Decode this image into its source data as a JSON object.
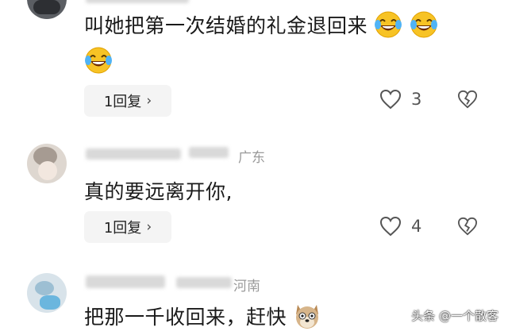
{
  "comments": [
    {
      "text": "叫她把第一次结婚的礼金退回来",
      "emoji": [
        "laughing-tears-emoji",
        "laughing-tears-emoji",
        "laughing-tears-emoji"
      ],
      "reply_label": "1回复",
      "like_count": "3"
    },
    {
      "location": "广东",
      "text": "真的要远离开你,",
      "reply_label": "1回复",
      "like_count": "4"
    },
    {
      "location": "河南",
      "text": "把那一千收回来，赶快",
      "emoji": [
        "dog-face-emoji"
      ]
    }
  ],
  "watermark": "头条 @一个散客",
  "colors": {
    "reply_bg": "#f4f4f4",
    "meta": "#9a9a9a",
    "emoji_yellow": "#f7c325"
  }
}
